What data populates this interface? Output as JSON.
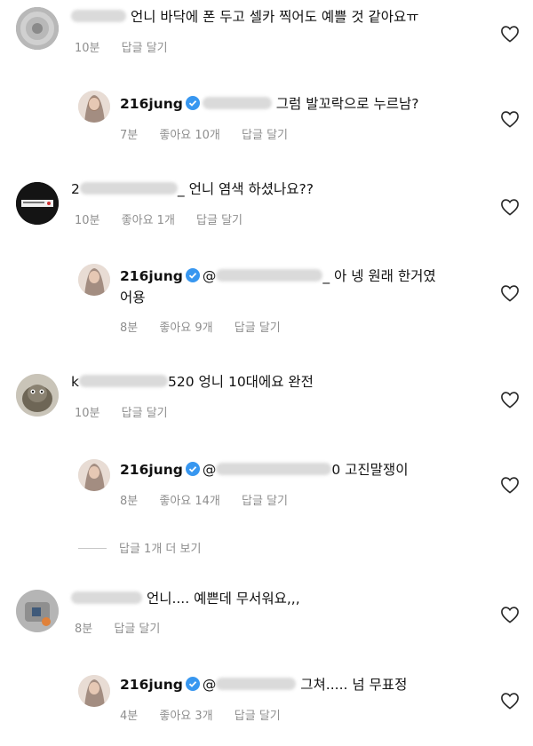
{
  "comments": [
    {
      "username_suffix": "",
      "text": "언니 바닥에 폰 두고 셀카 찍어도 예쁠 것 같아요ㅠ",
      "time": "10분",
      "likes": "",
      "reply": "답글 달기"
    },
    {
      "username": "216jung",
      "text": "그럼 발꼬락으로 누르남?",
      "time": "7분",
      "likes": "좋아요 10개",
      "reply": "답글 달기"
    },
    {
      "username_prefix": "2",
      "username_suffix": "_",
      "text": "언니 염색 하셨나요??",
      "time": "10분",
      "likes": "좋아요 1개",
      "reply": "답글 달기"
    },
    {
      "username": "216jung",
      "mention_prefix": "@",
      "mention_suffix": "_",
      "text_line1": "아 넹 원래 한거였",
      "text_line2": "어용",
      "time": "8분",
      "likes": "좋아요 9개",
      "reply": "답글 달기"
    },
    {
      "username_prefix": "k",
      "username_suffix": "520",
      "text": "엉니 10대에요 완전",
      "time": "10분",
      "likes": "",
      "reply": "답글 달기"
    },
    {
      "username": "216jung",
      "mention_prefix": "@",
      "mention_suffix": "0",
      "text": "고진말쟁이",
      "time": "8분",
      "likes": "좋아요 14개",
      "reply": "답글 달기"
    },
    {
      "text": "언니.... 예쁜데 무서워요,,,",
      "time": "8분",
      "likes": "",
      "reply": "답글 달기"
    },
    {
      "username": "216jung",
      "mention_prefix": "@",
      "text": "그쳐..... 넘 무표정",
      "time": "4분",
      "likes": "좋아요 3개",
      "reply": "답글 달기"
    }
  ],
  "more_replies": "답글 1개 더 보기",
  "icons": {
    "heart": "heart-outline-icon",
    "verified": "verified-badge-icon"
  },
  "colors": {
    "meta": "#8e8e8e",
    "verified": "#3897f0"
  }
}
